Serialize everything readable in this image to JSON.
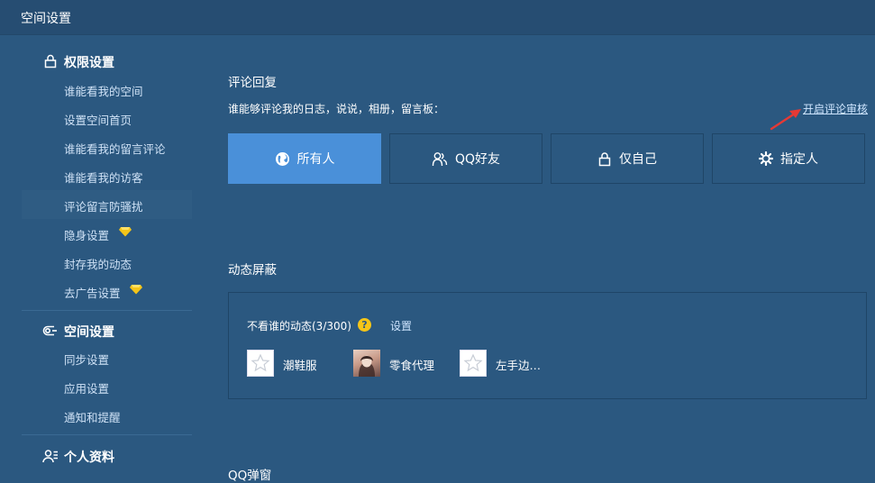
{
  "window": {
    "title": "空间设置"
  },
  "sidebar": {
    "sections": [
      {
        "label": "权限设置",
        "icon": "lock-icon",
        "items": [
          {
            "label": "谁能看我的空间"
          },
          {
            "label": "设置空间首页"
          },
          {
            "label": "谁能看我的留言评论"
          },
          {
            "label": "谁能看我的访客"
          },
          {
            "label": "评论留言防骚扰",
            "active": true
          },
          {
            "label": "隐身设置",
            "vip": true
          },
          {
            "label": "封存我的动态"
          },
          {
            "label": "去广告设置",
            "vip": true
          }
        ]
      },
      {
        "label": "空间设置",
        "icon": "toggle-icon",
        "items": [
          {
            "label": "同步设置"
          },
          {
            "label": "应用设置"
          },
          {
            "label": "通知和提醒"
          }
        ]
      },
      {
        "label": "个人资料",
        "icon": "profile-icon",
        "items": []
      }
    ]
  },
  "comment": {
    "heading": "评论回复",
    "description": "谁能够评论我的日志，说说，相册，留言板：",
    "audit_link": "开启评论审核",
    "options": [
      {
        "label": "所有人",
        "icon": "globe-icon",
        "selected": true
      },
      {
        "label": "QQ好友",
        "icon": "friends-icon",
        "selected": false
      },
      {
        "label": "仅自己",
        "icon": "lock-icon",
        "selected": false
      },
      {
        "label": "指定人",
        "icon": "gear-icon",
        "selected": false
      }
    ]
  },
  "feed_block": {
    "heading": "动态屏蔽",
    "hidden_label": "不看谁的动态(3/300)",
    "help_icon_text": "?",
    "settings_link": "设置",
    "users": [
      {
        "name": "潮鞋服",
        "avatar": "default"
      },
      {
        "name": "零食代理",
        "avatar": "photo"
      },
      {
        "name": "左手边…",
        "avatar": "default"
      }
    ]
  },
  "popup": {
    "heading": "QQ弹窗"
  },
  "colors": {
    "background": "#2b5880",
    "accent": "#4a90d9",
    "vip": "#f5c518",
    "arrow": "#e53935"
  }
}
